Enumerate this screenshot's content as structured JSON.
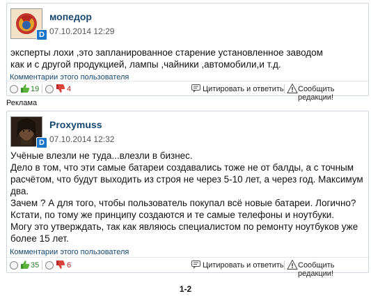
{
  "comments": [
    {
      "username": "мопедор",
      "date": "07.10.2014 12:29",
      "badge": "D",
      "text": "эксперты лохи ,это запланированное старение установленное заводом\nкак и с другой продукцией, лампы ,чайники ,автомобили,и т.д.",
      "user_comments_link": "Комментарии этого пользователя",
      "likes": "19",
      "dislikes": "4",
      "quote_label": "Цитировать и ответить",
      "report_label": "Сообщить редакции!"
    },
    {
      "username": "Proxymuss",
      "date": "07.10.2014 12:32",
      "badge": "D",
      "text": "Учёные влезли не туда...влезли в бизнес.\nДело в том, что эти самые батареи создавались тоже не от балды, а с точным\nрасчётом, что будут выходить из строя не через 5-10 лет, а через год. Максимум\nдва.\nЗачем ? А для того, чтобы пользователь покупал всё новые батареи. Логично?\nКстати, по тому же принципу создаются и те самые телефоны и ноутбуки.\nМогу это утверждать, так как являюсь специалистом по ремонту ноутбуков уже\nболее 15 лет.",
      "user_comments_link": "Комментарии этого пользователя",
      "likes": "35",
      "dislikes": "6",
      "quote_label": "Цитировать и ответить",
      "report_label": "Сообщить редакции!"
    }
  ],
  "ad_label": "Реклама",
  "pager": "1-2",
  "colors": {
    "username": "#17476f",
    "likes": "#2b7a2b",
    "dislikes": "#b52525",
    "badge": "#1a74c9"
  }
}
